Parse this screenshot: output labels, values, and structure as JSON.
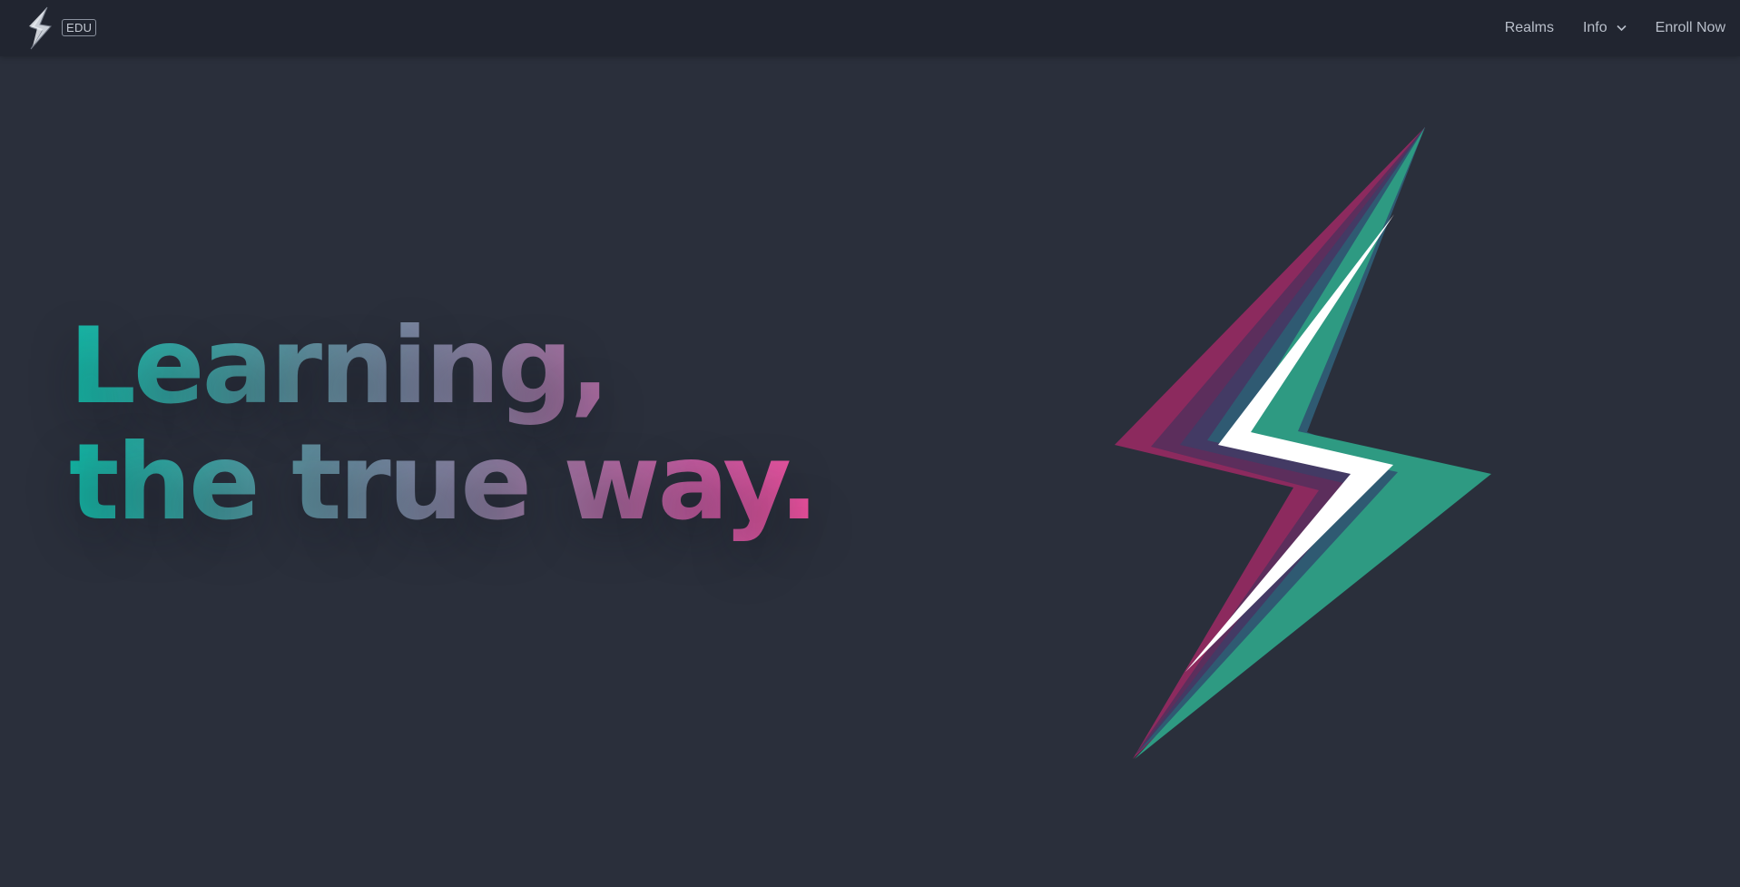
{
  "nav": {
    "badge": "EDU",
    "links": [
      "Realms",
      "Info",
      "Enroll Now"
    ]
  },
  "hero": {
    "line1": "Learning,",
    "line2": "the true way."
  },
  "colors": {
    "background": "#2a2f3b",
    "navbar": "#212530",
    "teal": "#14b8a6",
    "pink": "#ef4f9d",
    "bolt_teal": "#2e9a82",
    "bolt_magenta": "#8c2a5e"
  },
  "icons": [
    "lightning-logo-icon",
    "chevron-down-icon",
    "lightning-bolt-illustration"
  ]
}
